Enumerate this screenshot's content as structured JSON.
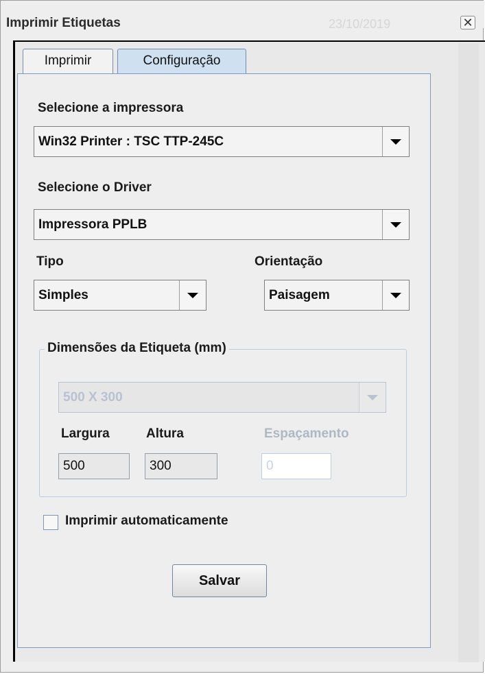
{
  "window": {
    "title": "Imprimir Etiquetas",
    "date": "23/10/2019",
    "close_symbol": "✕"
  },
  "tabs": [
    {
      "label": "Imprimir",
      "selected": false
    },
    {
      "label": "Configuração",
      "selected": true
    }
  ],
  "config": {
    "printer_label": "Selecione a impressora",
    "printer_value": "Win32 Printer : TSC TTP-245C",
    "driver_label": "Selecione o Driver",
    "driver_value": "Impressora PPLB",
    "tipo_label": "Tipo",
    "tipo_value": "Simples",
    "orientacao_label": "Orientação",
    "orientacao_value": "Paisagem",
    "dimensions_title": "Dimensões da Etiqueta (mm)",
    "dimensions_value": "500 X 300",
    "largura_label": "Largura",
    "largura_value": "500",
    "altura_label": "Altura",
    "altura_value": "300",
    "espacamento_label": "Espaçamento",
    "espacamento_value": "0",
    "auto_print_label": "Imprimir automaticamente",
    "auto_print_checked": false,
    "save_label": "Salvar"
  },
  "colors": {
    "tab_selected": "#cfe0f1",
    "panel_border": "#7a9cc2",
    "disabled_text": "#b7c3d1"
  },
  "icons": {
    "dropdown": "chevron-down-icon",
    "close": "close-icon"
  }
}
